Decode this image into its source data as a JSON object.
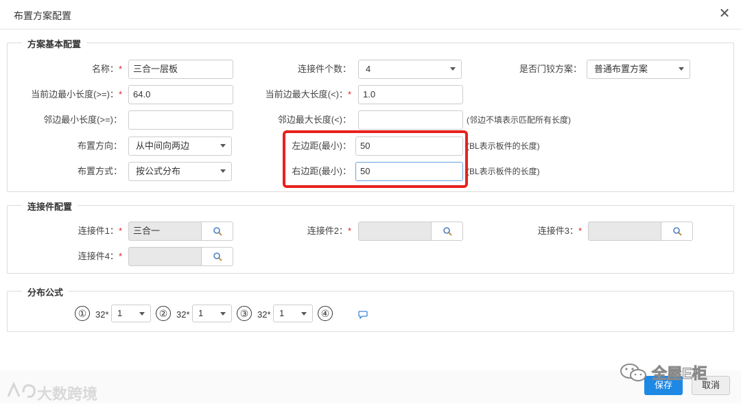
{
  "dialog": {
    "title": "布置方案配置"
  },
  "basic": {
    "legend": "方案基本配置",
    "name_label": "名称：",
    "name_value": "三合一层板",
    "connector_count_label": "连接件个数：",
    "connector_count_value": "4",
    "hinge_label": "是否门铰方案：",
    "hinge_value": "普通布置方案",
    "cur_min_label": "当前边最小长度(>=)：",
    "cur_min_value": "64.0",
    "cur_max_label": "当前边最大长度(<)：",
    "cur_max_value": "1.0",
    "adj_min_label": "邻边最小长度(>=)：",
    "adj_min_value": "",
    "adj_max_label": "邻边最大长度(<)：",
    "adj_max_value": "",
    "adj_note": "(邻边不填表示匹配所有长度)",
    "direction_label": "布置方向：",
    "direction_value": "从中间向两边",
    "left_margin_label": "左边距(最小)：",
    "left_margin_value": "50",
    "left_note": "(BL表示板件的长度)",
    "method_label": "布置方式：",
    "method_value": "按公式分布",
    "right_margin_label": "右边距(最小)：",
    "right_margin_value": "50",
    "right_note": "(BL表示板件的长度)",
    "required_mark": "*"
  },
  "connectors": {
    "legend": "连接件配置",
    "c1_label": "连接件1：",
    "c1_value": "三合一",
    "c2_label": "连接件2：",
    "c2_value": "",
    "c3_label": "连接件3：",
    "c3_value": "",
    "c4_label": "连接件4：",
    "c4_value": ""
  },
  "formula": {
    "legend": "分布公式",
    "n1": "①",
    "n2": "②",
    "n3": "③",
    "n4": "④",
    "m1": "32*",
    "m2": "32*",
    "m3": "32*",
    "s1": "1",
    "s2": "1",
    "s3": "1"
  },
  "footer": {
    "save": "保存",
    "cancel": "取消"
  },
  "watermark": {
    "left": "大数跨境",
    "right": "全屋E柜"
  }
}
